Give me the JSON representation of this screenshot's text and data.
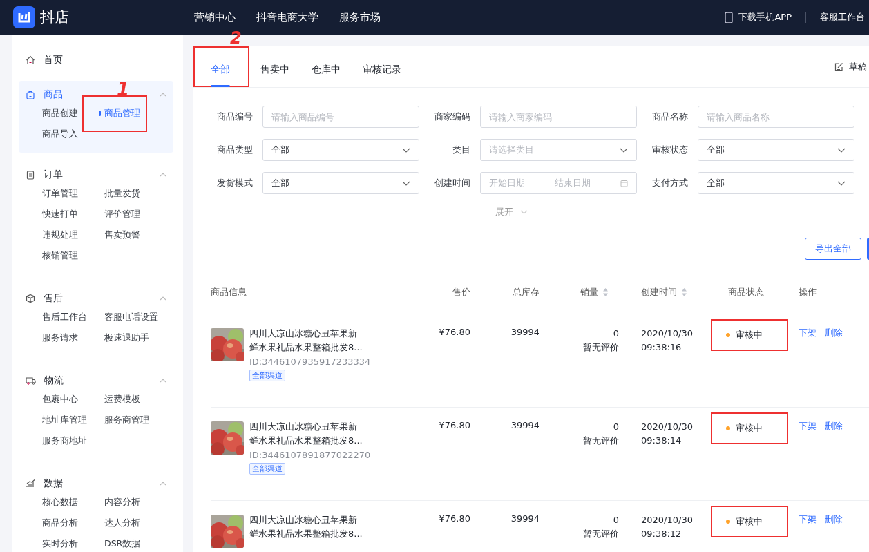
{
  "topbar": {
    "logo": "抖店",
    "nav": [
      "营销中心",
      "抖音电商大学",
      "服务市场"
    ],
    "download": "下载手机APP",
    "service": "客服工作台"
  },
  "sidebar": {
    "home": "首页",
    "groups": [
      {
        "title": "商品",
        "expanded": true,
        "active": true,
        "items": [
          {
            "label": "商品创建",
            "selected": false,
            "highlighted": false
          },
          {
            "label": "商品管理",
            "selected": true,
            "highlighted": true
          },
          {
            "label": "商品导入",
            "selected": false,
            "highlighted": false
          }
        ]
      },
      {
        "title": "订单",
        "expanded": true,
        "active": false,
        "items": [
          {
            "label": "订单管理",
            "selected": false,
            "highlighted": false
          },
          {
            "label": "批量发货",
            "selected": false,
            "highlighted": false
          },
          {
            "label": "快速打单",
            "selected": false,
            "highlighted": false
          },
          {
            "label": "评价管理",
            "selected": false,
            "highlighted": false
          },
          {
            "label": "违规处理",
            "selected": false,
            "highlighted": false
          },
          {
            "label": "售卖预警",
            "selected": false,
            "highlighted": false
          },
          {
            "label": "核销管理",
            "selected": false,
            "highlighted": false
          }
        ]
      },
      {
        "title": "售后",
        "expanded": true,
        "active": false,
        "items": [
          {
            "label": "售后工作台",
            "selected": false,
            "highlighted": false
          },
          {
            "label": "客服电话设置",
            "selected": false,
            "highlighted": false
          },
          {
            "label": "服务请求",
            "selected": false,
            "highlighted": false
          },
          {
            "label": "极速退助手",
            "selected": false,
            "highlighted": false
          }
        ]
      },
      {
        "title": "物流",
        "expanded": true,
        "active": false,
        "items": [
          {
            "label": "包裹中心",
            "selected": false,
            "highlighted": false
          },
          {
            "label": "运费模板",
            "selected": false,
            "highlighted": false
          },
          {
            "label": "地址库管理",
            "selected": false,
            "highlighted": false
          },
          {
            "label": "服务商管理",
            "selected": false,
            "highlighted": false
          },
          {
            "label": "服务商地址",
            "selected": false,
            "highlighted": false
          }
        ]
      },
      {
        "title": "数据",
        "expanded": true,
        "active": false,
        "items": [
          {
            "label": "核心数据",
            "selected": false,
            "highlighted": false
          },
          {
            "label": "内容分析",
            "selected": false,
            "highlighted": false
          },
          {
            "label": "商品分析",
            "selected": false,
            "highlighted": false
          },
          {
            "label": "达人分析",
            "selected": false,
            "highlighted": false
          },
          {
            "label": "实时分析",
            "selected": false,
            "highlighted": false
          },
          {
            "label": "DSR数据",
            "selected": false,
            "highlighted": false
          }
        ]
      }
    ]
  },
  "tabs": [
    {
      "label": "全部",
      "selected": true,
      "highlighted": true
    },
    {
      "label": "售卖中",
      "selected": false,
      "highlighted": false
    },
    {
      "label": "仓库中",
      "selected": false,
      "highlighted": false
    },
    {
      "label": "审核记录",
      "selected": false,
      "highlighted": false
    }
  ],
  "drafts": "草稿",
  "filters": [
    {
      "label": "商品编号",
      "kind": "input",
      "placeholder": "请输入商品编号"
    },
    {
      "label": "商家编码",
      "kind": "input",
      "placeholder": "请输入商家编码"
    },
    {
      "label": "商品名称",
      "kind": "input",
      "placeholder": "请输入商品名称"
    },
    {
      "label": "商品类型",
      "kind": "select",
      "value": "全部"
    },
    {
      "label": "类目",
      "kind": "select",
      "placeholder": "请选择类目"
    },
    {
      "label": "审核状态",
      "kind": "select",
      "value": "全部"
    },
    {
      "label": "发货模式",
      "kind": "select",
      "value": "全部"
    },
    {
      "label": "创建时间",
      "kind": "daterange",
      "start_placeholder": "开始日期",
      "separator": "–",
      "end_placeholder": "结束日期"
    },
    {
      "label": "支付方式",
      "kind": "select",
      "value": "全部"
    }
  ],
  "expand": "展开",
  "export_button": "导出全部",
  "table": {
    "columns": [
      {
        "label": "商品信息",
        "sortable": false
      },
      {
        "label": "售价",
        "sortable": false
      },
      {
        "label": "总库存",
        "sortable": false
      },
      {
        "label": "销量",
        "sortable": true
      },
      {
        "label": "创建时间",
        "sortable": true
      },
      {
        "label": "商品状态",
        "sortable": false
      },
      {
        "label": "操作",
        "sortable": false
      }
    ],
    "rows": [
      {
        "title": "四川大凉山冰糖心丑苹果新鲜水果礼品水果整箱批发8...",
        "id": "ID:3446107935917233334",
        "tag": "全部渠道",
        "price": "¥76.80",
        "stock": "39994",
        "sales": "0",
        "rating": "暂无评价",
        "date": "2020/10/30",
        "time": "09:38:16",
        "status": "审核中",
        "highlighted": true,
        "actions": [
          "下架",
          "删除"
        ]
      },
      {
        "title": "四川大凉山冰糖心丑苹果新鲜水果礼品水果整箱批发8...",
        "id": "ID:3446107891877022270",
        "tag": "全部渠道",
        "price": "¥76.80",
        "stock": "39994",
        "sales": "0",
        "rating": "暂无评价",
        "date": "2020/10/30",
        "time": "09:38:14",
        "status": "审核中",
        "highlighted": true,
        "actions": [
          "下架",
          "删除"
        ]
      },
      {
        "title": "四川大凉山冰糖心丑苹果新鲜水果礼品水果整箱批发8...",
        "price": "¥76.80",
        "stock": "39994",
        "sales": "0",
        "rating": "暂无评价",
        "date": "2020/10/30",
        "time": "09:38:12",
        "status": "审核中",
        "highlighted": true,
        "actions": [
          "下架",
          "删除"
        ]
      }
    ]
  },
  "annotations": [
    {
      "label": "1"
    },
    {
      "label": "2"
    }
  ]
}
